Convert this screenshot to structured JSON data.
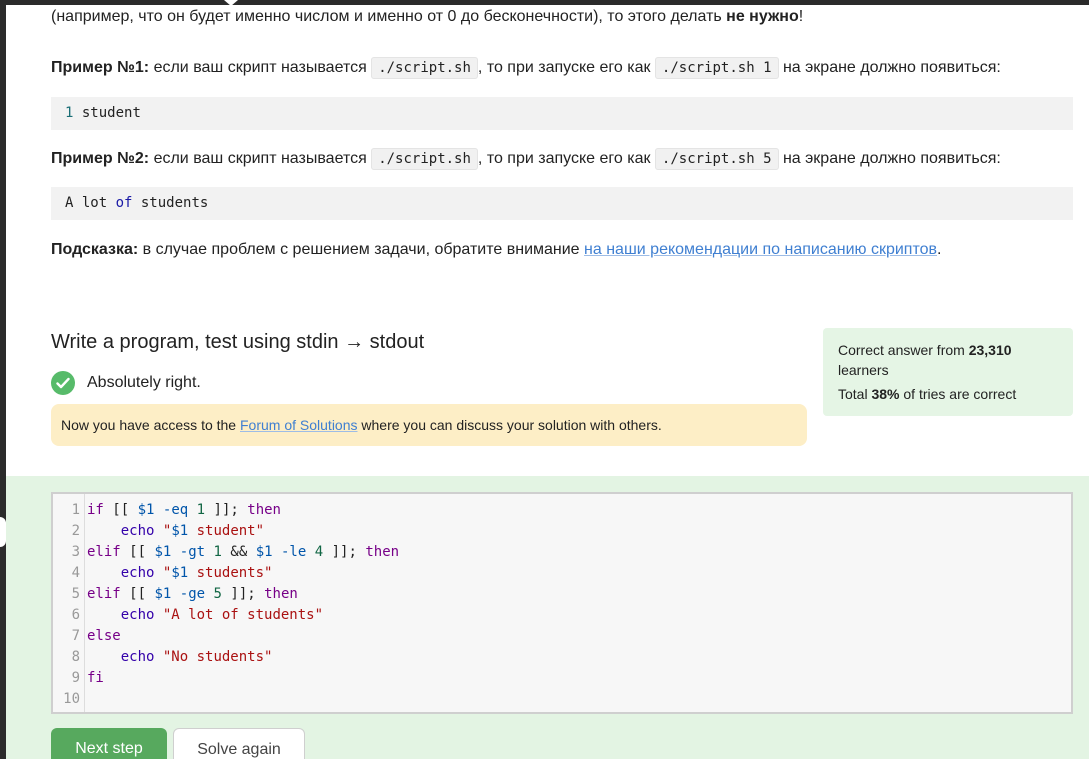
{
  "intro": {
    "line0_prefix": "(например, что он будет именно числом и именно от 0 до бесконечности), то этого делать ",
    "line0_bold": "не нужно",
    "line0_suffix": "!"
  },
  "example1": {
    "label": "Пример №1:",
    "text_a": " если ваш скрипт называется ",
    "code_a": "./script.sh",
    "text_b": ", то при запуске его как ",
    "code_b": "./script.sh 1",
    "text_c": " на экране должно появиться:",
    "output_num": "1",
    "output_text": " student"
  },
  "example2": {
    "label": "Пример №2:",
    "text_a": " если ваш скрипт называется ",
    "code_a": "./script.sh",
    "text_b": ", то при запуске его как ",
    "code_b": "./script.sh 5",
    "text_c": " на экране должно появиться:",
    "output_a": "A lot ",
    "output_kw": "of",
    "output_b": " students"
  },
  "hint": {
    "label": "Подсказка:",
    "text": " в случае проблем с решением задачи, обратите внимание ",
    "link": "на наши рекомендации по написанию скриптов",
    "suffix": "."
  },
  "task": {
    "title": "Write a program, test using stdin → stdout",
    "status": "Absolutely right.",
    "notice_prefix": "Now you have access to the ",
    "notice_link": "Forum of Solutions",
    "notice_suffix": " where you can discuss your solution with others."
  },
  "stats": {
    "line1_prefix": "Correct answer from ",
    "learners_count": "23,310",
    "line1_suffix": "learners",
    "line2_prefix": "Total ",
    "percent": "38%",
    "line2_suffix": " of tries are correct"
  },
  "editor": {
    "line_numbers": [
      "1",
      "2",
      "3",
      "4",
      "5",
      "6",
      "7",
      "8",
      "9",
      "10"
    ],
    "lines": [
      "if [[ $1 -eq 1 ]]; then",
      "    echo \"$1 student\"",
      "elif [[ $1 -gt 1 && $1 -le 4 ]]; then",
      "    echo \"$1 students\"",
      "elif [[ $1 -ge 5 ]]; then",
      "    echo \"A lot of students\"",
      "else",
      "    echo \"No students\"",
      "fi",
      ""
    ]
  },
  "buttons": {
    "next_step": "Next step",
    "solve_again": "Solve again"
  },
  "colors": {
    "primary": "#57a95e",
    "success_icon": "#57bb6a",
    "notice_bg": "#fdeec6",
    "stats_bg": "#e5f5e5",
    "editor_section_bg": "#e3f4e3",
    "link": "#3f7fd1"
  }
}
